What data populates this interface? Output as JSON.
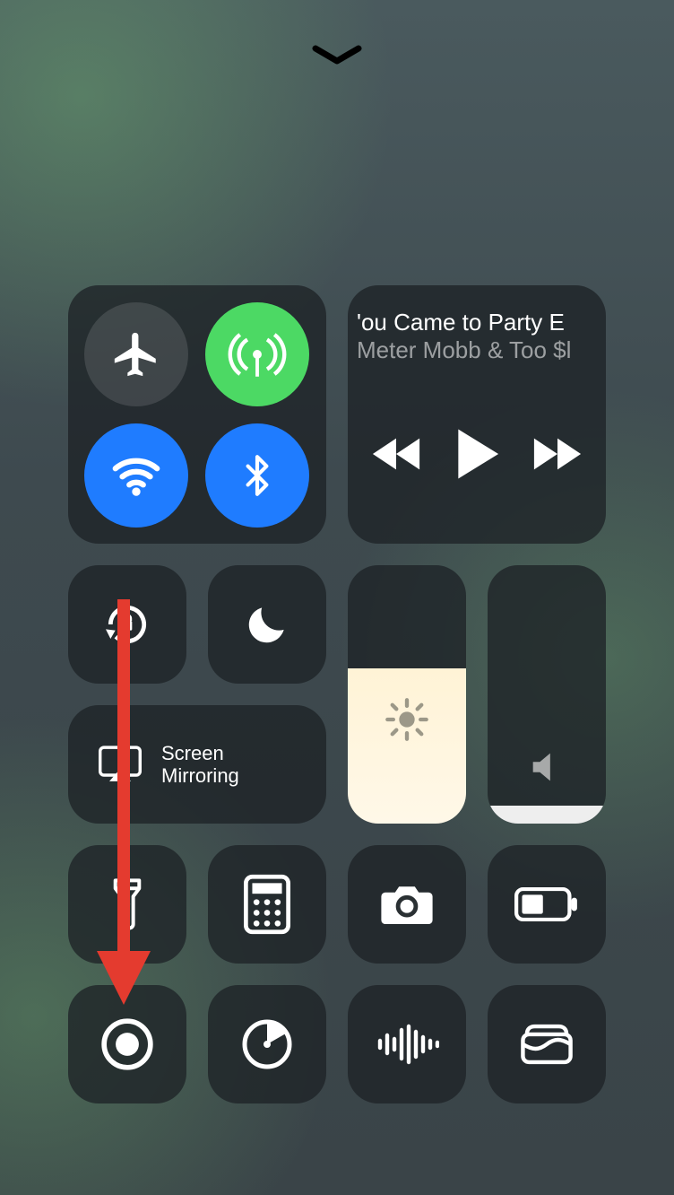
{
  "handle": {
    "name": "control-center-collapse-chevron"
  },
  "connectivity": {
    "airplane": {
      "on": false,
      "name": "airplane-mode-toggle"
    },
    "cellular": {
      "on": true,
      "name": "cellular-data-toggle"
    },
    "wifi": {
      "on": true,
      "name": "wifi-toggle"
    },
    "bluetooth": {
      "on": true,
      "name": "bluetooth-toggle"
    }
  },
  "media": {
    "title": "'ou Came to Party E",
    "artist": "Meter Mobb & Too $l",
    "controls": {
      "prev": "previous-track-button",
      "play": "play-button",
      "next": "next-track-button"
    }
  },
  "toggles": {
    "orientation_lock": {
      "name": "orientation-lock-toggle"
    },
    "dnd": {
      "name": "do-not-disturb-toggle"
    }
  },
  "screen_mirroring": {
    "label_line1": "Screen",
    "label_line2": "Mirroring"
  },
  "sliders": {
    "brightness": {
      "level_pct": 60
    },
    "volume": {
      "level_pct": 5
    }
  },
  "shortcuts_row1": {
    "flashlight": "flashlight-button",
    "calculator": "calculator-button",
    "camera": "camera-button",
    "low_power": "low-power-mode-button"
  },
  "shortcuts_row2": {
    "screen_record": "screen-recording-button",
    "timer": "timer-button",
    "voice_memo": "voice-memos-button",
    "wallet": "wallet-button"
  },
  "annotation": {
    "kind": "arrow",
    "color": "#e43b2f",
    "points_to": "screen-recording-button"
  }
}
